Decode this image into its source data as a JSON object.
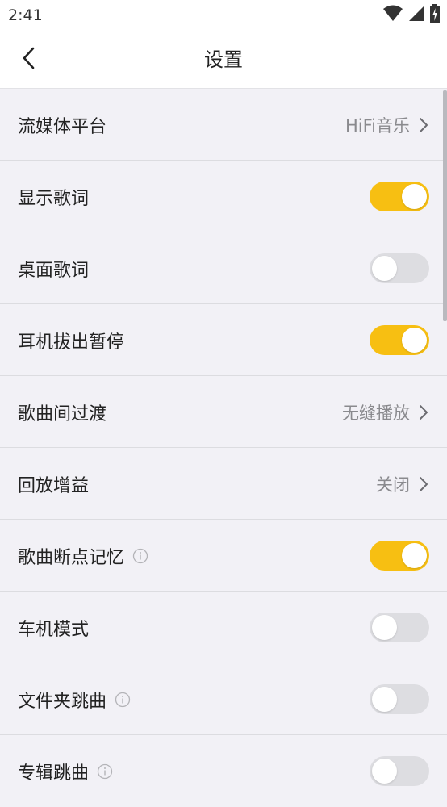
{
  "status_bar": {
    "time": "2:41",
    "icons": [
      "wifi-icon",
      "signal-icon",
      "battery-charging-icon"
    ]
  },
  "header": {
    "title": "设置",
    "back_icon": "chevron-left-icon"
  },
  "settings": {
    "rows": [
      {
        "label": "流媒体平台",
        "value": "HiFi音乐"
      },
      {
        "label": "显示歌词",
        "toggle": true
      },
      {
        "label": "桌面歌词",
        "toggle": false
      },
      {
        "label": "耳机拔出暂停",
        "toggle": true
      },
      {
        "label": "歌曲间过渡",
        "value": "无缝播放"
      },
      {
        "label": "回放增益",
        "value": "关闭"
      },
      {
        "label": "歌曲断点记忆",
        "toggle": true,
        "info": true
      },
      {
        "label": "车机模式",
        "toggle": false
      },
      {
        "label": "文件夹跳曲",
        "toggle": false,
        "info": true
      },
      {
        "label": "专辑跳曲",
        "toggle": false,
        "info": true
      }
    ]
  },
  "colors": {
    "accent": "#f7bf12",
    "toggle_off": "#dddde1",
    "background": "#f2f1f6",
    "secondary_text": "#8a8a8e"
  }
}
